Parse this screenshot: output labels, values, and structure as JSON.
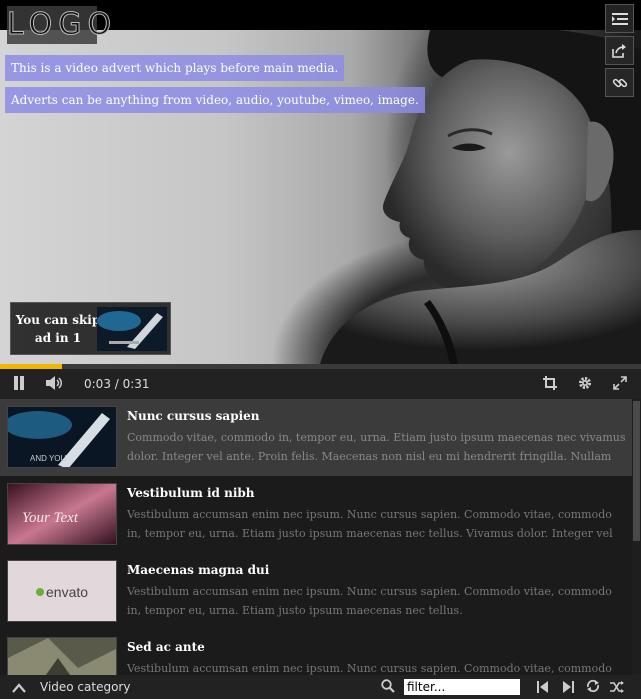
{
  "logo": {
    "text": "LOGO"
  },
  "ad": {
    "message1": "This is a video advert which plays before main media.",
    "message2": "Adverts can be anything from video, audio, youtube, vimeo, image.",
    "skip_line1": "You can skip",
    "skip_line2": "ad in 1"
  },
  "side_buttons": [
    "playlist-icon",
    "share-icon",
    "link-icon"
  ],
  "progress": {
    "fraction": 0.0968,
    "color": "#f2b600"
  },
  "controls": {
    "time": "0:03 / 0:31",
    "left_icons": [
      "pause-icon",
      "volume-icon"
    ],
    "right_icons": [
      "crop-icon",
      "gear-icon",
      "fullscreen-icon"
    ]
  },
  "playlist": {
    "items": [
      {
        "title": "Nunc cursus sapien",
        "description": "Commodo vitae, commodo in, tempor eu, urna. Etiam justo ipsum maecenas nec vivamus dolor. Integer vel ante. Proin felis. Maecenas non nisl eu mi hendrerit fringilla. Nullam vel ante et nunc accumsan viverra.",
        "thumb_text": "AND YOU",
        "active": true
      },
      {
        "title": "Vestibulum id nibh",
        "description": "Vestibulum accumsan enim nec ipsum. Nunc cursus sapien. Commodo vitae, commodo in, tempor eu, urna. Etiam justo ipsum maecenas nec tellus. Vivamus dolor. Integer vel ante. Proin felis. Maecenas non nisl eu...",
        "thumb_text": "Your Text",
        "active": false
      },
      {
        "title": "Maecenas magna dui",
        "description": "Vestibulum accumsan enim nec ipsum. Nunc cursus sapien. Commodo vitae, commodo in, tempor eu, urna. Etiam justo ipsum maecenas nec tellus.",
        "thumb_text": "envato",
        "active": false
      },
      {
        "title": "Sed ac ante",
        "description": "Vestibulum accumsan enim nec ipsum. Nunc cursus sapien. Commodo vitae, commodo in, tempor eu, urna.",
        "thumb_text": "",
        "active": false
      }
    ]
  },
  "bottom": {
    "category_label": "Video category",
    "filter_placeholder": "filter...",
    "icons": [
      "chevron-up-icon",
      "search-icon",
      "previous-icon",
      "next-icon",
      "loop-icon",
      "shuffle-icon"
    ]
  }
}
